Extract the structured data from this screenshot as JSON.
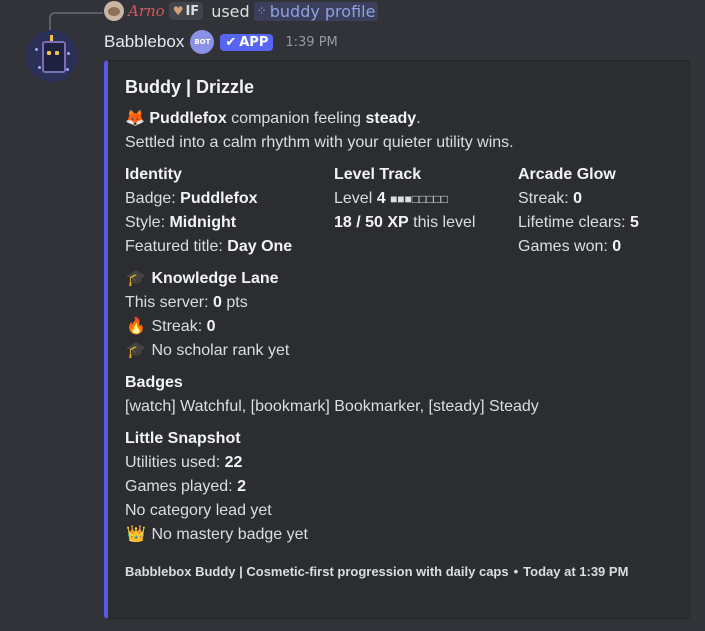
{
  "reply": {
    "username": "Arno",
    "guild_tag": "IF",
    "used_text": "used",
    "command": "buddy profile"
  },
  "message": {
    "bot_name": "Babblebox",
    "bot_badge_text": "BOT",
    "app_tag": "APP",
    "timestamp": "1:39 PM"
  },
  "embed": {
    "accent_color": "#5b57e8",
    "title": "Buddy | Drizzle",
    "companion": {
      "emoji": "🦊",
      "name": "Puddlefox",
      "middle": "companion feeling",
      "mood": "steady",
      "end": ".",
      "description": "Settled into a calm rhythm with your quieter utility wins."
    },
    "identity": {
      "name": "Identity",
      "badge_label": "Badge:",
      "badge_value": "Puddlefox",
      "style_label": "Style:",
      "style_value": "Midnight",
      "title_label": "Featured title:",
      "title_value": "Day One"
    },
    "level_track": {
      "name": "Level Track",
      "level_label": "Level",
      "level_value": "4",
      "level_bar": "■■■□□□□□",
      "xp_value": "18 / 50 XP",
      "xp_suffix": "this level"
    },
    "arcade_glow": {
      "name": "Arcade Glow",
      "streak_label": "Streak:",
      "streak_value": "0",
      "clears_label": "Lifetime clears:",
      "clears_value": "5",
      "won_label": "Games won:",
      "won_value": "0"
    },
    "knowledge": {
      "emoji": "🎓",
      "name": "Knowledge Lane",
      "server_label": "This server:",
      "server_value": "0",
      "server_unit": "pts",
      "streak_emoji": "🔥",
      "streak_label": "Streak:",
      "streak_value": "0",
      "rank_emoji": "🎓",
      "rank_text": "No scholar rank yet"
    },
    "badges": {
      "name": "Badges",
      "text": "[watch] Watchful, [bookmark] Bookmarker, [steady] Steady"
    },
    "snapshot": {
      "name": "Little Snapshot",
      "utilities_label": "Utilities used:",
      "utilities_value": "22",
      "games_label": "Games played:",
      "games_value": "2",
      "category_text": "No category lead yet",
      "mastery_emoji": "👑",
      "mastery_text": "No mastery badge yet"
    },
    "footer": {
      "text": "Babblebox Buddy | Cosmetic-first progression with daily caps",
      "separator": "•",
      "timestamp": "Today at 1:39 PM"
    }
  }
}
